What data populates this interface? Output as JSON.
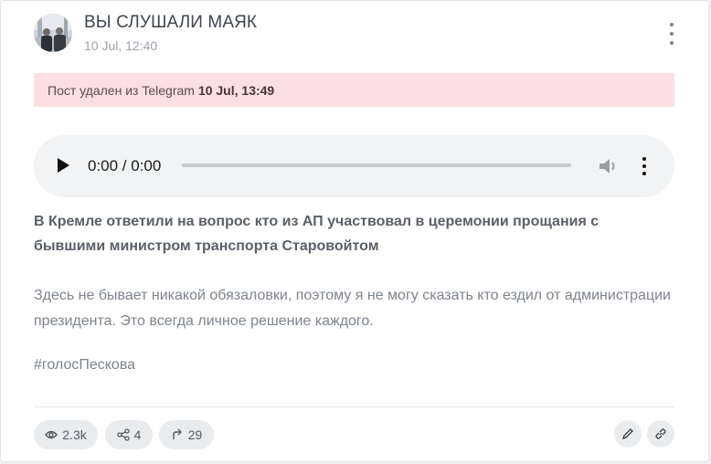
{
  "post": {
    "channel_name": "ВЫ СЛУШАЛИ МАЯК",
    "date": "10 Jul, 12:40"
  },
  "alert": {
    "text": "Пост удален из Telegram",
    "deleted_at": "10 Jul, 13:49"
  },
  "audio": {
    "time": "0:00 / 0:00"
  },
  "content": {
    "headline": "В Кремле ответили на вопрос кто из АП участвовал в церемонии прощания с бывшими министром транспорта Старовойтом",
    "body": "Здесь не бывает никакой обязаловки, поэтому я не могу сказать кто ездил от администрации президента. Это всегда личное решение каждого.",
    "hashtag": "#голосПескова"
  },
  "stats": {
    "views": "2.3k",
    "shares": "4",
    "forwards": "29"
  },
  "icons": {
    "views": "eye-icon",
    "shares": "share-icon",
    "forwards": "forward-icon",
    "edit": "pencil-icon",
    "link": "link-icon",
    "menu": "kebab-icon"
  },
  "colors": {
    "alert_bg": "#fbdfe1",
    "pill_bg": "#e9ecef",
    "audio_bg": "#f1f3f4"
  }
}
